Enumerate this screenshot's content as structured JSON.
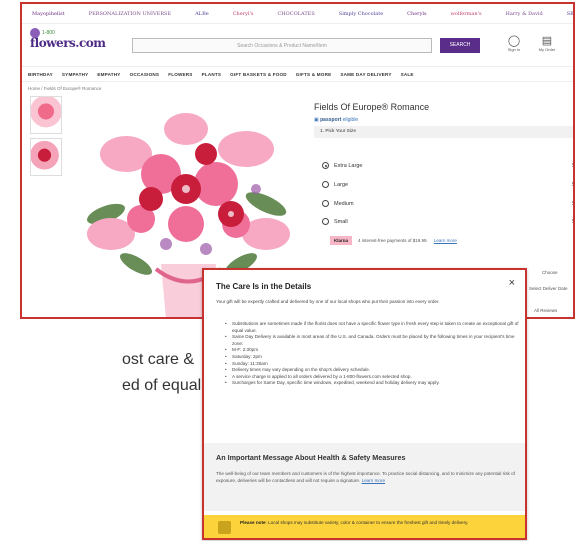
{
  "brand_bar": [
    "Mayopihelist",
    "PERSONALIZATION UNIVERSE",
    "ALBe",
    "Cheryl's",
    "CHOCOLATES",
    "Simply Chocolate",
    "Cheryls",
    "wolferman's",
    "Harry & David",
    "SB"
  ],
  "header": {
    "logo_top": "1-800",
    "logo_bottom": "flowers.com",
    "search_placeholder": "Search Occasions & Product Name/Item",
    "search_button": "SEARCH",
    "sign_in_label": "Sign In",
    "cart_label": "My Order"
  },
  "nav": [
    "BIRTHDAY",
    "SYMPATHY",
    "EMPATHY",
    "OCCASIONS",
    "FLOWERS",
    "PLANTS",
    "GIFT BASKETS & FOOD",
    "GIFTS & MORE",
    "SAME DAY DELIVERY",
    "SALE"
  ],
  "breadcrumb": "Home / Fields Of Europe® Romance",
  "product": {
    "title": "Fields Of Europe® Romance",
    "passport_brand": "passport",
    "passport_status": "eligible",
    "pick_label": "1. Pick Your Size",
    "options": [
      {
        "label": "Extra Large",
        "price": "$1",
        "selected": true
      },
      {
        "label": "Large",
        "price": "$1",
        "selected": false
      },
      {
        "label": "Medium",
        "price": "$1",
        "selected": false
      },
      {
        "label": "Small",
        "price": "$1",
        "selected": false
      }
    ],
    "klarna_badge": "Klarna",
    "klarna_text": "4 interest-free payments of $19.99.",
    "klarna_link": "Learn more"
  },
  "side_text": [
    "Choose",
    "Select Deliver Date",
    "All Reviews"
  ],
  "care_modal": {
    "title": "The Care Is in the Details",
    "close": "×",
    "intro": "Your gift will be expertly crafted and delivered by one of our local shops who put their passion into every order.",
    "bullets": [
      "Substitutions are sometimes made if the florist does not have a specific flower type in fresh every step is taken to create an exceptional gift of equal value.",
      "Same Day Delivery is available in most areas of the U.S. and Canada. Orders must be placed by the following times in your recipient's time zone:",
      "M-F: 2:30pm",
      "Saturday: 2pm",
      "Sunday: 11:30am",
      "Delivery times may vary depending on the shop's delivery schedule.",
      "A service charge is applied to all orders delivered by a 1-800-flowers.com selected shop.",
      "Surcharges for Same Day, specific time windows, expedited, weekend and holiday delivery may apply."
    ],
    "health_title": "An Important Message About Health & Safety Measures",
    "health_body": "The well-being of our team members and customers is of the highest importance. To practice social distancing, and to minimize any potential risk of exposure, deliveries will be contactless and will not require a signature.",
    "health_link": "Learn more",
    "note_bold": "Please note",
    "note_text": ": Local shops may substitute variety, color & container to ensure the freshest gift and timely delivery."
  },
  "bg_text": [
    "ost care &",
    "ed of equal"
  ]
}
